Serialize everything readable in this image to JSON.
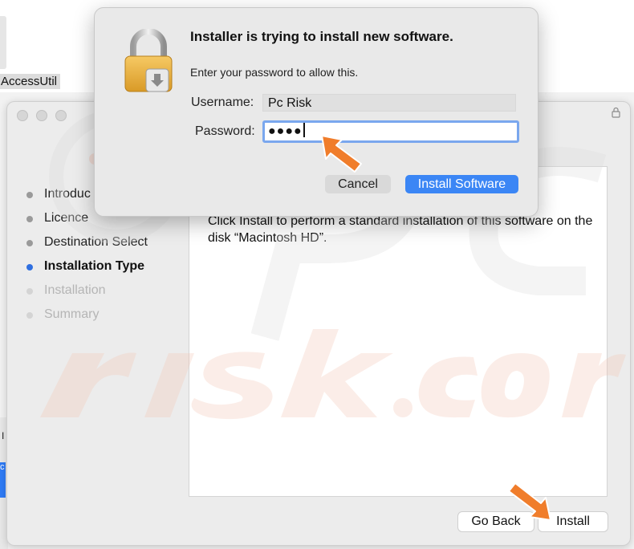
{
  "background": {
    "app_label": "AccessUtil",
    "bottom_char": "I",
    "blue_char": "c"
  },
  "installer": {
    "steps": [
      {
        "label": "Introduc",
        "state": "done"
      },
      {
        "label": "Licence",
        "state": "done"
      },
      {
        "label": "Destination Select",
        "state": "done"
      },
      {
        "label": "Installation Type",
        "state": "current"
      },
      {
        "label": "Installation",
        "state": "pending"
      },
      {
        "label": "Summary",
        "state": "pending"
      }
    ],
    "body_text": "Click Install to perform a standard installation of this software on the disk “Macintosh HD”.",
    "go_back_label": "Go Back",
    "install_label": "Install"
  },
  "auth_dialog": {
    "title": "Installer is trying to install new software.",
    "subtitle": "Enter your password to allow this.",
    "username_label": "Username:",
    "username_value": "Pc Risk",
    "password_label": "Password:",
    "password_value": "●●●●",
    "cancel_label": "Cancel",
    "install_software_label": "Install Software"
  },
  "colors": {
    "accent_blue": "#3b86f5",
    "current_step_dot": "#2f6fe0",
    "done_step_dot": "#9a9a9a",
    "pending_step_dot": "#d4d4d4",
    "annotation_arrow": "#f07d2b"
  },
  "icons": {
    "dialog_icon": "padlock-icon",
    "window_lock": "lock-icon",
    "annotation": "arrow-pointer-icon"
  }
}
